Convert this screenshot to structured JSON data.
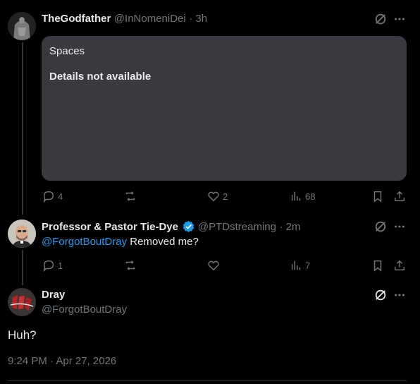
{
  "post1": {
    "name": "TheGodfather",
    "handle": "@InNomeniDei",
    "time": "· 3h",
    "card": {
      "title": "Spaces",
      "subtitle": "Details not available"
    },
    "actions": {
      "replies": "4",
      "likes": "2",
      "views": "68"
    }
  },
  "post2": {
    "name": "Professor & Pastor Tie-Dye",
    "handle": "@PTDstreaming",
    "time": "· 2m",
    "mention": "@ForgotBoutDray",
    "text": " Removed me?",
    "actions": {
      "replies": "1",
      "views": "7"
    }
  },
  "post3": {
    "name": "Dray",
    "handle": "@ForgotBoutDray",
    "text": "Huh?",
    "timestamp": "9:24 PM · Apr 27, 2026"
  },
  "colors": {
    "background": "#000000",
    "accent": "#1d9bf0",
    "muted": "#71767b",
    "verified": "#1d9bf0"
  }
}
